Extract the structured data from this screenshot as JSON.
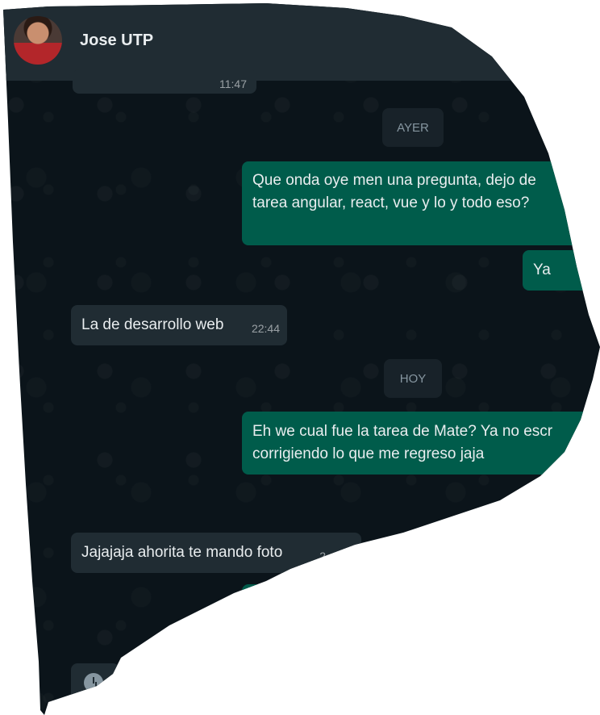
{
  "contact": {
    "name": "Jose UTP"
  },
  "messages": [
    {
      "type": "incoming",
      "text": "",
      "time": "11:47"
    },
    {
      "type": "date",
      "text": "AYER"
    },
    {
      "type": "outgoing",
      "text": "Que onda oye men una pregunta, dejo de tarea angular, react, vue y lo y todo eso?"
    },
    {
      "type": "outgoing",
      "text": "Ya"
    },
    {
      "type": "incoming",
      "text": "La de desarrollo web",
      "time": "22:44"
    },
    {
      "type": "date",
      "text": "HOY"
    },
    {
      "type": "outgoing",
      "text": "Eh we cual fue la tarea de Mate? Ya no escr corrigiendo lo que me regreso jaja"
    },
    {
      "type": "incoming",
      "text": "Jajajaja ahorita te mando foto",
      "time": "2"
    }
  ],
  "colors": {
    "header": "#202c33",
    "chat_bg": "#0b141a",
    "incoming_bubble": "#202c33",
    "outgoing_bubble": "#005c4b",
    "date_chip": "#182229"
  },
  "icons": [
    "avatar-photo",
    "clock-icon"
  ]
}
